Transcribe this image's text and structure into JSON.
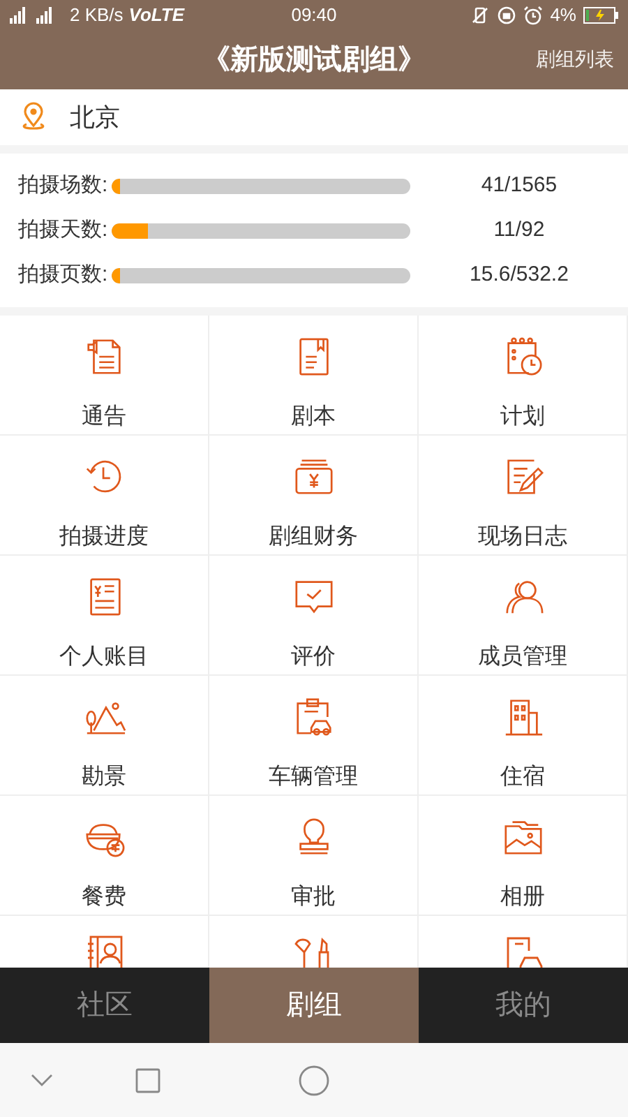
{
  "status_bar": {
    "speed": "2 KB/s",
    "network": "VoLTE",
    "time": "09:40",
    "battery": "4%"
  },
  "header": {
    "title": "《新版测试剧组》",
    "action": "剧组列表"
  },
  "location": {
    "city": "北京"
  },
  "stats": [
    {
      "label": "拍摄场数:",
      "level": 0.026,
      "reading": "41/1565"
    },
    {
      "label": "拍摄天数:",
      "level": 0.12,
      "reading": "11/92"
    },
    {
      "label": "拍摄页数:",
      "level": 0.029,
      "reading": "15.6/532.2"
    }
  ],
  "grid": [
    {
      "kind": "full",
      "label": "通告"
    },
    {
      "kind": "full",
      "label": "剧本"
    },
    {
      "kind": "full",
      "label": "计划"
    },
    {
      "kind": "full",
      "label": "拍摄进度"
    },
    {
      "kind": "full",
      "label": "剧组财务"
    },
    {
      "kind": "full",
      "label": "现场日志"
    },
    {
      "kind": "full",
      "label": "个人账目"
    },
    {
      "kind": "full",
      "label": "评价"
    },
    {
      "kind": "full",
      "label": "成员管理"
    },
    {
      "kind": "full",
      "label": "勘景"
    },
    {
      "kind": "full",
      "label": "车辆管理"
    },
    {
      "kind": "full",
      "label": "住宿"
    },
    {
      "kind": "full",
      "label": "餐费"
    },
    {
      "kind": "full",
      "label": "审批"
    },
    {
      "kind": "full",
      "label": "相册"
    },
    {
      "kind": "cut"
    },
    {
      "kind": "cut"
    },
    {
      "kind": "cut"
    }
  ],
  "tabs": [
    {
      "label": "社区",
      "selected": false
    },
    {
      "label": "剧组",
      "selected": true
    },
    {
      "label": "我的",
      "selected": false
    }
  ]
}
